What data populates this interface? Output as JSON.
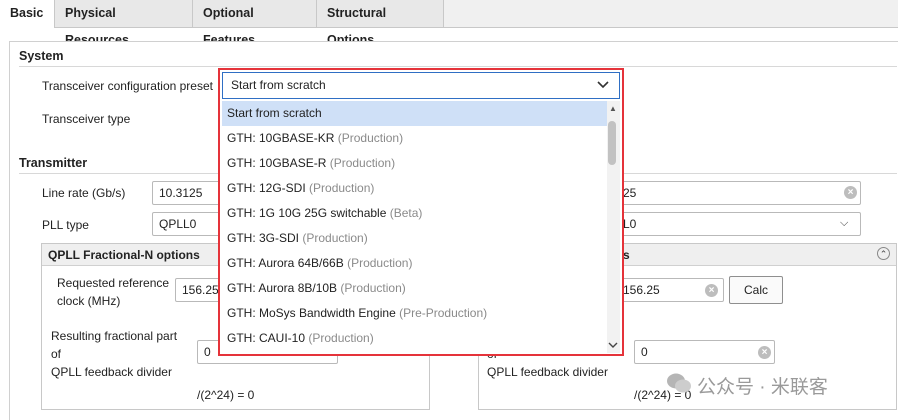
{
  "tabs": [
    {
      "label": "Basic"
    },
    {
      "label": "Physical Resources"
    },
    {
      "label": "Optional Features"
    },
    {
      "label": "Structural Options"
    }
  ],
  "system": {
    "title": "System",
    "preset_label": "Transceiver configuration preset",
    "preset_value": "Start from scratch",
    "type_label": "Transceiver type"
  },
  "transmitter": {
    "title": "Transmitter",
    "line_rate_label": "Line rate (Gb/s)",
    "line_rate_value": "10.3125",
    "pll_type_label": "PLL type",
    "pll_type_value": "QPLL0",
    "qpll_group_title": "QPLL Fractional-N options",
    "ref_clock_label_line1": "Requested reference",
    "ref_clock_label_line2": "clock (MHz)",
    "ref_clock_value": "156.25",
    "frac_label_line1": "Resulting fractional part",
    "frac_label_line2": "of",
    "frac_label_line3": "QPLL feedback divider",
    "frac_value": "0",
    "formula": "/(2^24) = 0"
  },
  "receiver": {
    "line_rate_value": "25",
    "pll_type_value": "L0",
    "group_title_fragment": "s",
    "ref_clock_value": "156.25",
    "calc_label": "Calc",
    "frac_label_partial": "of",
    "frac_label_line3": "QPLL feedback divider",
    "frac_value": "0",
    "formula": "/(2^24) = 0"
  },
  "dropdown": {
    "items": [
      {
        "name": "Start from scratch",
        "status": ""
      },
      {
        "name": "GTH: 10GBASE-KR",
        "status": "(Production)"
      },
      {
        "name": "GTH: 10GBASE-R",
        "status": "(Production)"
      },
      {
        "name": "GTH: 12G-SDI",
        "status": "(Production)"
      },
      {
        "name": "GTH: 1G 10G 25G switchable",
        "status": "(Beta)"
      },
      {
        "name": "GTH: 3G-SDI",
        "status": "(Production)"
      },
      {
        "name": "GTH: Aurora 64B/66B",
        "status": "(Production)"
      },
      {
        "name": "GTH: Aurora 8B/10B",
        "status": "(Production)"
      },
      {
        "name": "GTH: MoSys Bandwidth Engine",
        "status": "(Pre-Production)"
      },
      {
        "name": "GTH: CAUI-10",
        "status": "(Production)"
      }
    ]
  },
  "watermark": "公众号 · 米联客",
  "icons": {
    "clear": "clear-x-icon",
    "chevron": "chevron-down-icon",
    "collapse": "collapse-up-icon"
  }
}
